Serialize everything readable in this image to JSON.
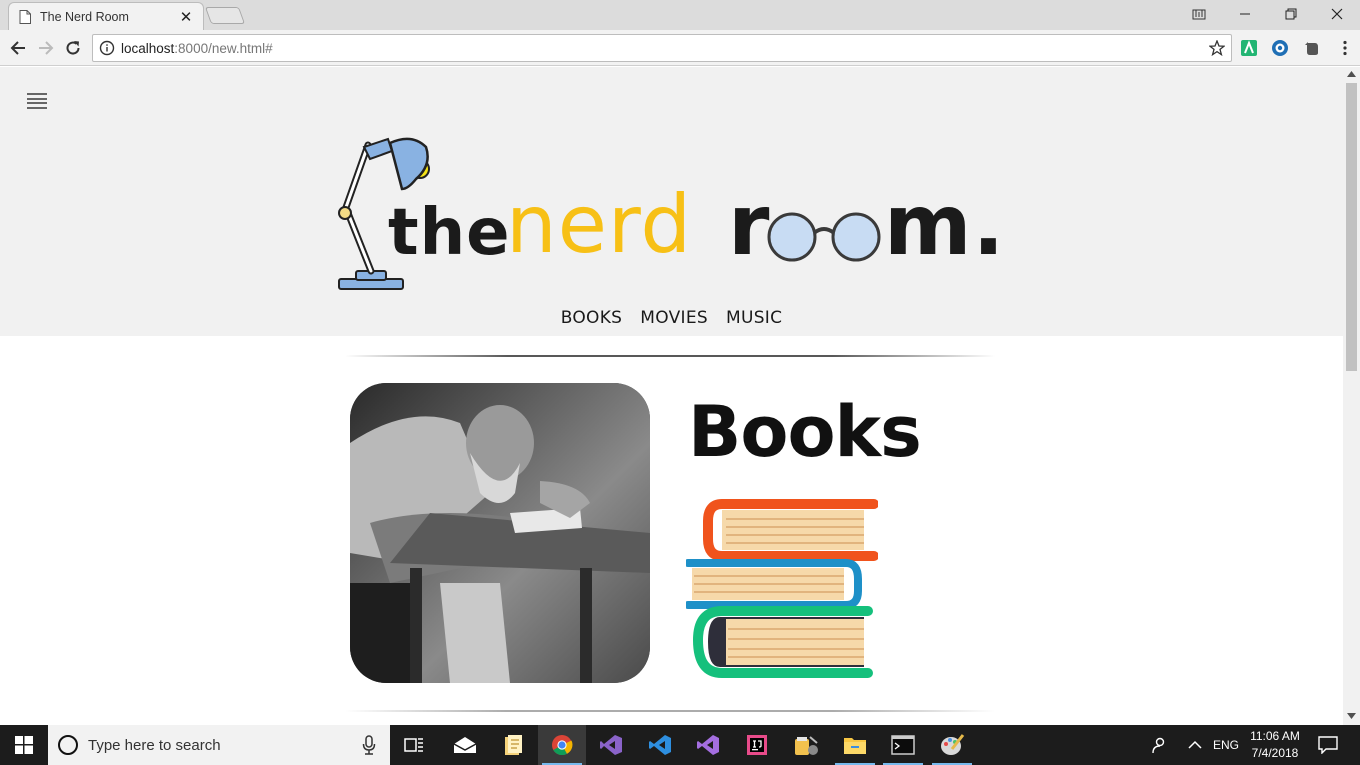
{
  "browser": {
    "tab_title": "The Nerd Room",
    "tab_close": "✕",
    "url_host": "localhost",
    "url_rest": ":8000/new.html#"
  },
  "page": {
    "logo": {
      "word1": "the",
      "word2": "nerd",
      "word3_start": "r",
      "word3_end": "m."
    },
    "nav": {
      "books": "BOOKS",
      "movies": "MOVIES",
      "music": "MUSIC"
    },
    "section_title": "Books",
    "colors": {
      "logo_yellow": "#f7c016",
      "logo_dark": "#1b1b1b",
      "lamp_blue": "#89b2e2",
      "book_orange": "#f0531c",
      "book_blue": "#1e90c8",
      "book_green": "#15c07c"
    }
  },
  "taskbar": {
    "search_placeholder": "Type here to search",
    "language": "ENG",
    "time": "11:06 AM",
    "date": "7/4/2018"
  }
}
